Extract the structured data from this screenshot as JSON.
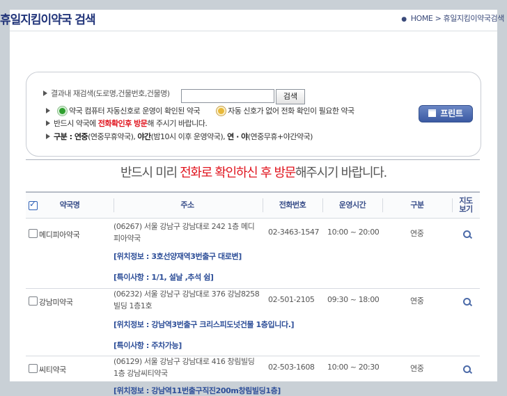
{
  "header": {
    "title": "휴일지킴이약국 검색",
    "breadcrumb_home": "HOME",
    "breadcrumb_sep": ">",
    "breadcrumb_current": "휴일지킴이약국검색"
  },
  "search": {
    "label": "결과내 재검색(도로명,건물번호,건물명)",
    "input_value": "",
    "button": "검색"
  },
  "legend": {
    "confirmed": "약국 컴퓨터 자동신호로 운영이 확인된 약국",
    "need_call": "자동 신호가 없어 전화 확인이 필요한 약국"
  },
  "notes": {
    "n1_pre": "반드시 약국에 ",
    "n1_red": "전화확인후 방문",
    "n1_post": "해 주시기 바랍니다.",
    "n2_label": "구분 : ",
    "n2_a_b": "연중",
    "n2_a": "(연중무휴약국), ",
    "n2_b_b": "야간",
    "n2_b": "(밤10시 이후 운영약국), ",
    "n2_c_b": "연 · 야",
    "n2_c": "(연중무휴+야간약국)"
  },
  "print_button": "프린트",
  "notice": {
    "pre": "반드시 미리 ",
    "red": "전화로 확인하신 후 방문",
    "post": "해주시기 바랍니다."
  },
  "table": {
    "headers": {
      "name": "약국명",
      "address": "주소",
      "phone": "전화번호",
      "hours": "운영시간",
      "kind": "구분",
      "map_line1": "지도",
      "map_line2": "보기"
    },
    "rows": [
      {
        "name": "메디피아약국",
        "address": "(06267) 서울 강남구 강남대로 242 1층 메디피아약국",
        "phone": "02-3463-1547",
        "hours": "10:00 ~ 20:00",
        "kind": "연중",
        "location": "[위치정보 : 3호선양재역3번출구 대로변]",
        "special": "[특이사항 : 1/1, 설날 ,추석 쉼]"
      },
      {
        "name": "강남미약국",
        "address": "(06232) 서울 강남구 강남대로 376 강남8258빌딩 1층1호",
        "phone": "02-501-2105",
        "hours": "09:30 ~ 18:00",
        "kind": "연중",
        "location": "[위치정보 : 강남역3번출구 크리스피도넛건물 1층입니다.]",
        "special": "[특이사항 : 주차가능]"
      },
      {
        "name": "씨티약국",
        "address": "(06129) 서울 강남구 강남대로 416 창림빌딩 1층 강남씨티약국",
        "phone": "02-503-1608",
        "hours": "10:00 ~ 20:30",
        "kind": "연중",
        "location": "[위치정보 : 강남역11번출구직진200m창림빌딩1층]"
      }
    ]
  }
}
